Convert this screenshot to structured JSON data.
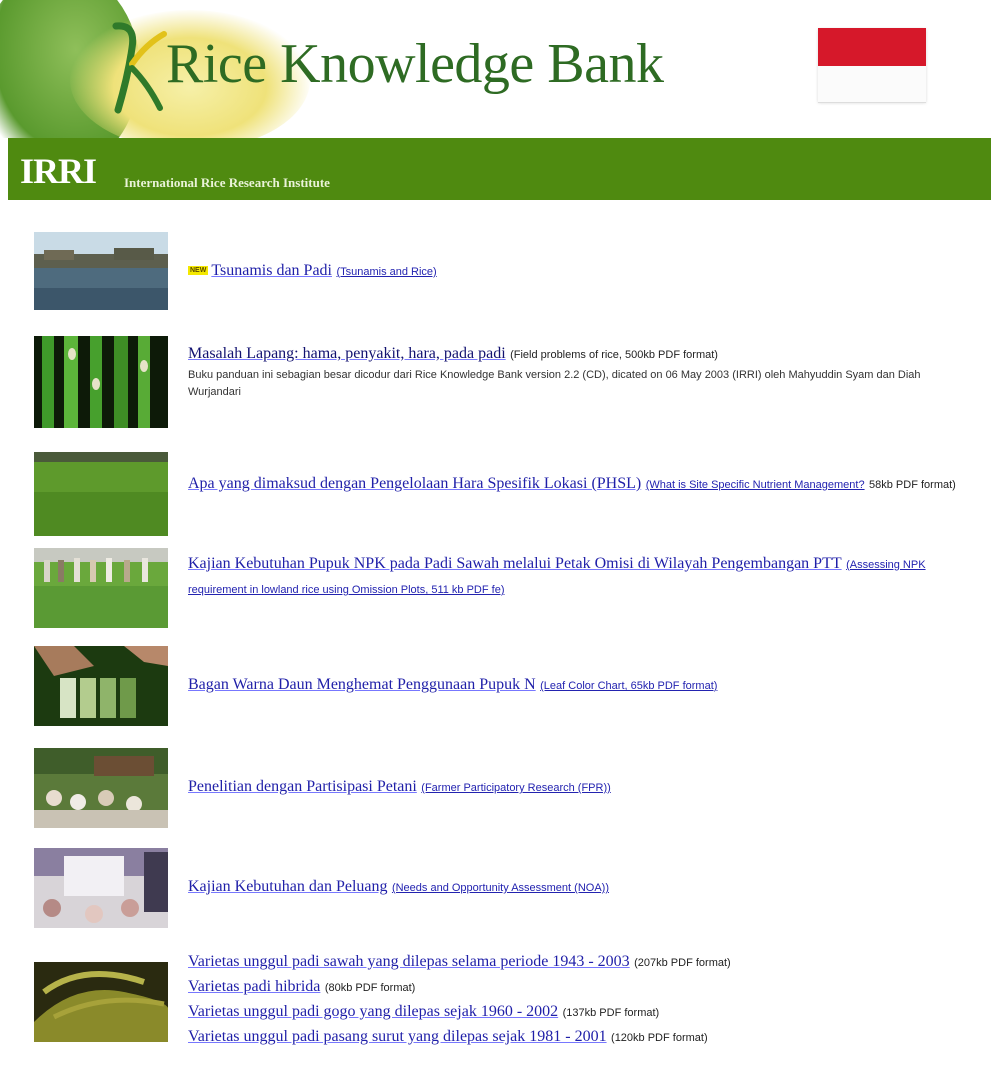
{
  "header": {
    "title": "Rice Knowledge Bank",
    "org_short": "IRRI",
    "org_name": "International Rice Research Institute",
    "colors": {
      "title": "#2e6b23",
      "bar": "#4f8a10",
      "flag_red": "#d6182a"
    }
  },
  "items": [
    {
      "badge": "NEW",
      "title": "Tsunamis dan Padi",
      "subtitle": "(Tsunamis and Rice)",
      "meta": "",
      "description": ""
    },
    {
      "title": "Masalah Lapang: hama, penyakit, hara, pada padi",
      "subtitle": "",
      "meta": "(Field problems of rice, 500kb PDF format)",
      "description": "Buku panduan ini sebagian besar dicodur dari Rice Knowledge Bank version 2.2 (CD), dicated on 06 May 2003 (IRRI) oleh Mahyuddin Syam dan Diah Wurjandari"
    },
    {
      "title": "Apa yang dimaksud dengan Pengelolaan Hara Spesifik Lokasi (PHSL)",
      "subtitle": "(What is Site Specific Nutrient Management?",
      "meta": "58kb PDF format)",
      "description": ""
    },
    {
      "title": "Kajian Kebutuhan Pupuk NPK pada Padi Sawah melalui Petak Omisi di Wilayah Pengembangan PTT",
      "subtitle": "",
      "meta": "(Assessing NPK requirement in lowland rice using Omission Plots, 511 kb PDF fe)",
      "description": ""
    },
    {
      "title": "Bagan Warna Daun Menghemat Penggunaan Pupuk N",
      "subtitle": "",
      "meta": "(Leaf Color Chart, 65kb PDF format)",
      "description": ""
    },
    {
      "title": "Penelitian dengan Partisipasi Petani",
      "subtitle": "(Farmer Participatory Research (FPR))",
      "meta": "",
      "description": ""
    },
    {
      "title": "Kajian Kebutuhan dan Peluang",
      "subtitle": "(Needs and Opportunity Assessment (NOA))",
      "meta": "",
      "description": ""
    },
    {
      "links": [
        {
          "title": "Varietas unggul padi sawah yang dilepas selama periode 1943 - 2003",
          "meta": "(207kb PDF format)"
        },
        {
          "title": "Varietas padi hibrida",
          "meta": "(80kb PDF format)"
        },
        {
          "title": "Varietas unggul padi gogo yang dilepas sejak 1960 - 2002",
          "meta": "(137kb PDF format)"
        },
        {
          "title": "Varietas unggul padi pasang surut yang dilepas sejak 1981 - 2001",
          "meta": "(120kb PDF format)"
        }
      ]
    }
  ]
}
